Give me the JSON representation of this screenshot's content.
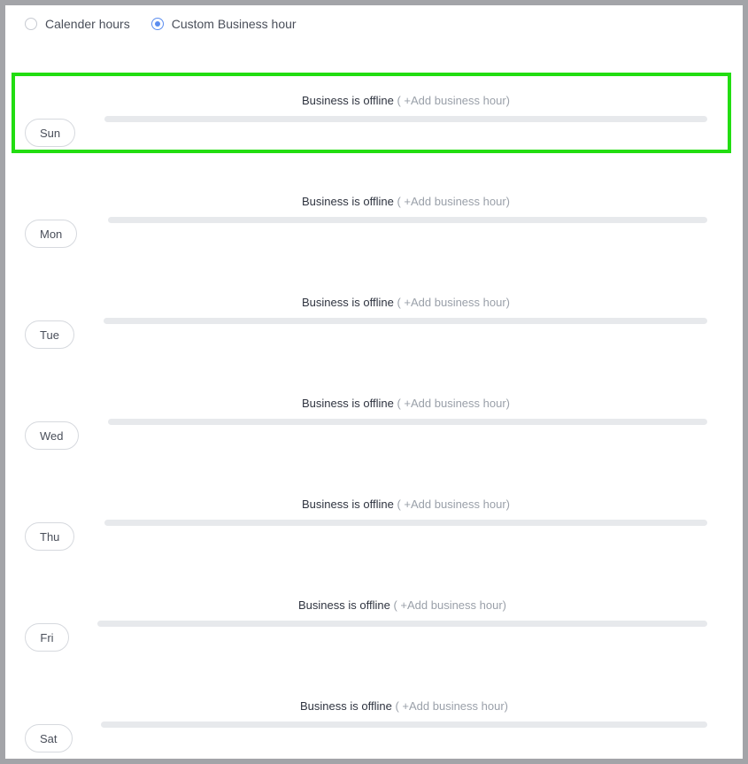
{
  "hours_type": {
    "options": [
      {
        "label": "Calender hours",
        "selected": false
      },
      {
        "label": "Custom Business hour",
        "selected": true
      }
    ]
  },
  "days": [
    {
      "label": "Sun",
      "status": "Business is offline",
      "add": "( +Add business hour)"
    },
    {
      "label": "Mon",
      "status": "Business is offline",
      "add": "( +Add business hour)"
    },
    {
      "label": "Tue",
      "status": "Business is offline",
      "add": "( +Add business hour)"
    },
    {
      "label": "Wed",
      "status": "Business is offline",
      "add": "( +Add business hour)"
    },
    {
      "label": "Thu",
      "status": "Business is offline",
      "add": "( +Add business hour)"
    },
    {
      "label": "Fri",
      "status": "Business is offline",
      "add": "( +Add business hour)"
    },
    {
      "label": "Sat",
      "status": "Business is offline",
      "add": "( +Add business hour)"
    }
  ],
  "colors": {
    "highlight": "#22dd11",
    "radio_selected": "#5b8def",
    "bar": "#e7e9ec"
  }
}
